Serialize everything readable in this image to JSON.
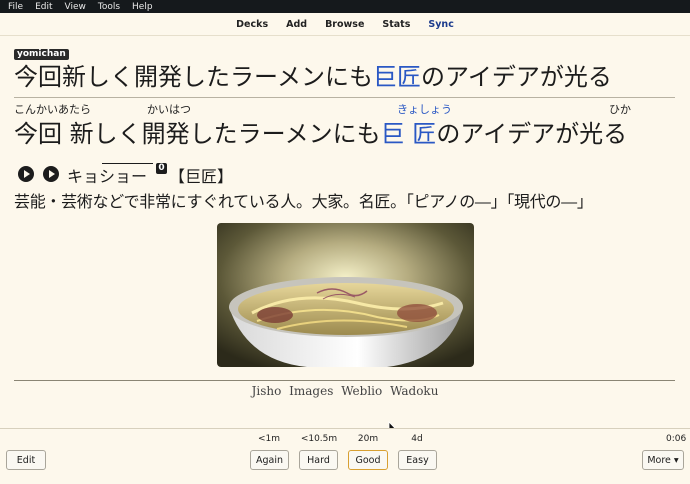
{
  "menu": [
    "File",
    "Edit",
    "View",
    "Tools",
    "Help"
  ],
  "toolbar": [
    "Decks",
    "Add",
    "Browse",
    "Stats",
    "Sync"
  ],
  "card": {
    "tag": "yomichan",
    "sentence_pre": "今回新しく開発したラーメンにも",
    "sentence_target": "巨匠",
    "sentence_post": "のアイデアが光る",
    "furigana": [
      {
        "text": "こんかいあたら",
        "highlight": false
      },
      {
        "text": "かいはつ",
        "highlight": false
      },
      {
        "text": "きょしょう",
        "highlight": true
      },
      {
        "text": "ひか",
        "highlight": false
      }
    ],
    "sentence2_a": "今回 新しく開発したラーメンにも",
    "sentence2_target": "巨 匠",
    "sentence2_post": "のアイデアが光る",
    "reading": "キョショー",
    "pitch": "0",
    "word": "【巨匠】",
    "definition": "芸能・芸術などで非常にすぐれている人。大家。名匠。「ピアノの―」「現代の―」",
    "image_alt": "ramen bowl",
    "links": [
      "Jisho",
      "Images",
      "Weblio",
      "Wadoku"
    ]
  },
  "bottom": {
    "edit_label": "Edit",
    "more_label": "More ▾",
    "timer": "0:06",
    "answers": [
      {
        "label": "Again",
        "interval": "<1m"
      },
      {
        "label": "Hard",
        "interval": "<10.5m"
      },
      {
        "label": "Good",
        "interval": "20m"
      },
      {
        "label": "Easy",
        "interval": "4d"
      }
    ]
  }
}
